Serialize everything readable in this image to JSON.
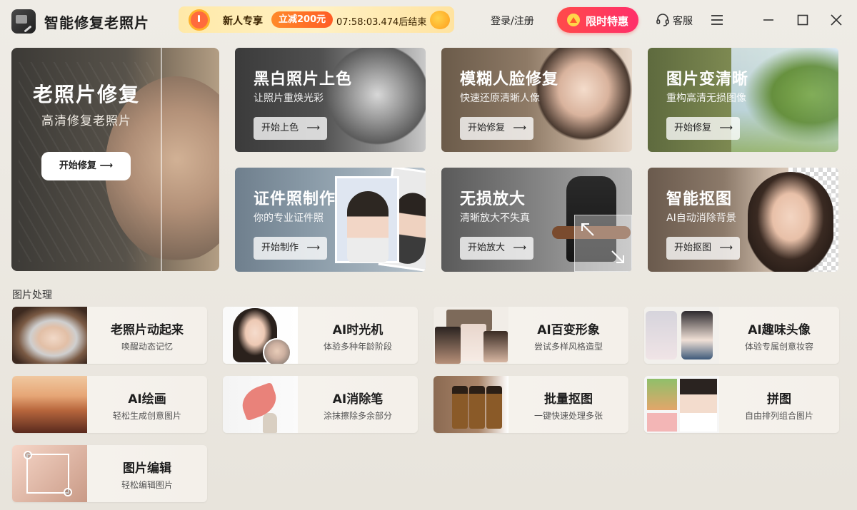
{
  "app": {
    "title": "智能修复老照片"
  },
  "promo": {
    "label": "新人专享",
    "badge": "立减200元",
    "countdown": "07:58:03.474后结束"
  },
  "header": {
    "login": "登录/注册",
    "vip": "限时特惠",
    "service": "客服"
  },
  "hero": {
    "title": "老照片修复",
    "subtitle": "高清修复老照片",
    "button": "开始修复"
  },
  "features": [
    {
      "title": "黑白照片上色",
      "subtitle": "让照片重焕光彩",
      "button": "开始上色"
    },
    {
      "title": "模糊人脸修复",
      "subtitle": "快速还原清晰人像",
      "button": "开始修复"
    },
    {
      "title": "图片变清晰",
      "subtitle": "重构高清无损图像",
      "button": "开始修复"
    },
    {
      "title": "证件照制作",
      "subtitle": "你的专业证件照",
      "button": "开始制作"
    },
    {
      "title": "无损放大",
      "subtitle": "清晰放大不失真",
      "button": "开始放大"
    },
    {
      "title": "智能抠图",
      "subtitle": "AI自动消除背景",
      "button": "开始抠图"
    }
  ],
  "section": {
    "title": "图片处理"
  },
  "tools": [
    {
      "title": "老照片动起来",
      "subtitle": "唤醒动态记忆"
    },
    {
      "title": "AI时光机",
      "subtitle": "体验多种年龄阶段"
    },
    {
      "title": "AI百变形象",
      "subtitle": "尝试多样风格造型"
    },
    {
      "title": "AI趣味头像",
      "subtitle": "体验专属创意妆容"
    },
    {
      "title": "AI绘画",
      "subtitle": "轻松生成创意图片"
    },
    {
      "title": "AI消除笔",
      "subtitle": "涂抹擦除多余部分"
    },
    {
      "title": "批量抠图",
      "subtitle": "一键快速处理多张"
    },
    {
      "title": "拼图",
      "subtitle": "自由排列组合图片"
    },
    {
      "title": "图片编辑",
      "subtitle": "轻松编辑图片"
    }
  ],
  "colors": {
    "vip_gradient_start": "#ff4a4a",
    "vip_gradient_end": "#ff2f6a",
    "promo_badge": "#ff6a28"
  }
}
